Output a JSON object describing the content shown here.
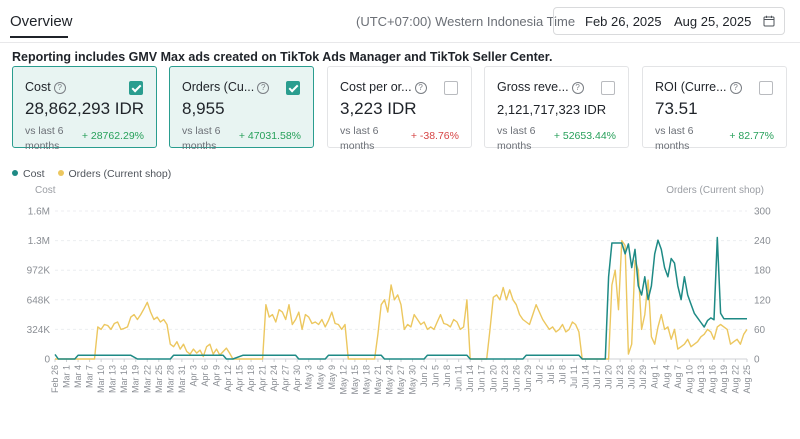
{
  "header": {
    "tab_label": "Overview",
    "timezone": "(UTC+07:00) Western Indonesia Time",
    "date_start": "Feb 26, 2025",
    "date_separator": "-",
    "date_end": "Aug 25, 2025",
    "calendar_icon": "calendar-icon"
  },
  "notice": "Reporting includes GMV Max ads created on TikTok Ads Manager and TikTok Seller Center.",
  "metrics": [
    {
      "title": "Cost",
      "value": "28,862,293 IDR",
      "vs": "vs last 6 months",
      "change": "+ 28762.29%",
      "direction": "up",
      "checked": true
    },
    {
      "title": "Orders (Cu...",
      "value": "8,955",
      "vs": "vs last 6 months",
      "change": "+ 47031.58%",
      "direction": "up",
      "checked": true
    },
    {
      "title": "Cost per or...",
      "value": "3,223 IDR",
      "vs": "vs last 6 months",
      "change": "+ -38.76%",
      "direction": "down",
      "checked": false
    },
    {
      "title": "Gross reve...",
      "value": "2,121,717,323 IDR",
      "vs": "vs last 6 months",
      "change": "+ 52653.44%",
      "direction": "up",
      "checked": false
    },
    {
      "title": "ROI (Curre...",
      "value": "73.51",
      "vs": "vs last 6 months",
      "change": "+ 82.77%",
      "direction": "up",
      "checked": false
    }
  ],
  "colors": {
    "cost": "#1e8a85",
    "orders": "#ecc75f",
    "accent": "#2a9d8f",
    "up": "#27a05a",
    "down": "#d64545"
  },
  "chart_data": {
    "type": "line",
    "legend": [
      "Cost",
      "Orders (Current shop)"
    ],
    "y_left_label": "Cost",
    "y_right_label": "Orders (Current shop)",
    "y_left_ticks": [
      "0",
      "324K",
      "648K",
      "972K",
      "1.3M",
      "1.6M"
    ],
    "y_right_ticks": [
      "0",
      "60",
      "120",
      "180",
      "240",
      "300"
    ],
    "y_left_range": [
      0,
      1620000
    ],
    "y_right_range": [
      0,
      300
    ],
    "x_start": "2025-02-26",
    "x_labels": [
      "Feb 26",
      "Mar 1",
      "Mar 4",
      "Mar 7",
      "Mar 10",
      "Mar 13",
      "Mar 16",
      "Mar 19",
      "Mar 22",
      "Mar 25",
      "Mar 28",
      "Mar 31",
      "Apr 3",
      "Apr 6",
      "Apr 9",
      "Apr 12",
      "Apr 15",
      "Apr 18",
      "Apr 21",
      "Apr 24",
      "Apr 27",
      "Apr 30",
      "May 3",
      "May 6",
      "May 9",
      "May 12",
      "May 15",
      "May 18",
      "May 21",
      "May 24",
      "May 27",
      "May 30",
      "Jun 2",
      "Jun 5",
      "Jun 8",
      "Jun 11",
      "Jun 14",
      "Jun 17",
      "Jun 20",
      "Jun 23",
      "Jun 26",
      "Jun 29",
      "Jul 2",
      "Jul 5",
      "Jul 8",
      "Jul 11",
      "Jul 14",
      "Jul 17",
      "Jul 20",
      "Jul 23",
      "Jul 26",
      "Jul 29",
      "Aug 1",
      "Aug 4",
      "Aug 7",
      "Aug 10",
      "Aug 13",
      "Aug 16",
      "Aug 19",
      "Aug 22",
      "Aug 25"
    ],
    "cost_series": {
      "name": "Cost",
      "segments": [
        [
          0,
          50000
        ],
        [
          1,
          0
        ],
        [
          5,
          0
        ],
        [
          6,
          0
        ],
        [
          7,
          40000
        ],
        [
          8,
          40000
        ],
        [
          23,
          40000
        ],
        [
          25,
          0
        ],
        [
          35,
          0
        ],
        [
          36,
          40000
        ],
        [
          51,
          40000
        ],
        [
          52,
          0
        ],
        [
          54,
          0
        ],
        [
          57,
          40000
        ],
        [
          73,
          40000
        ],
        [
          74,
          0
        ],
        [
          82,
          0
        ],
        [
          83,
          40000
        ],
        [
          99,
          40000
        ],
        [
          100,
          0
        ],
        [
          112,
          0
        ],
        [
          113,
          40000
        ],
        [
          125,
          40000
        ],
        [
          126,
          0
        ],
        [
          142,
          0
        ],
        [
          143,
          40000
        ],
        [
          159,
          40000
        ],
        [
          160,
          0
        ],
        [
          167,
          0
        ],
        [
          168,
          900000
        ],
        [
          169,
          1270000
        ],
        [
          172,
          1270000
        ],
        [
          173,
          1150000
        ],
        [
          174,
          1260000
        ],
        [
          175,
          1000000
        ],
        [
          176,
          1200000
        ],
        [
          177,
          800000
        ],
        [
          178,
          700000
        ],
        [
          179,
          900000
        ],
        [
          180,
          650000
        ],
        [
          181,
          800000
        ],
        [
          182,
          1150000
        ],
        [
          183,
          1300000
        ],
        [
          184,
          1200000
        ],
        [
          185,
          1000000
        ],
        [
          186,
          900000
        ],
        [
          187,
          1100000
        ],
        [
          188,
          1050000
        ],
        [
          189,
          800000
        ],
        [
          190,
          650000
        ],
        [
          191,
          900000
        ],
        [
          192,
          700000
        ],
        [
          193,
          600000
        ],
        [
          194,
          500000
        ],
        [
          195,
          450000
        ],
        [
          196,
          400000
        ],
        [
          197,
          350000
        ],
        [
          198,
          420000
        ],
        [
          199,
          450000
        ],
        [
          200,
          430000
        ],
        [
          201,
          1330000
        ],
        [
          202,
          500000
        ],
        [
          203,
          440000
        ],
        [
          204,
          440000
        ],
        [
          210,
          440000
        ]
      ]
    },
    "orders_series": {
      "name": "Orders (Current shop)",
      "values": [
        [
          0,
          0
        ],
        [
          12,
          0
        ],
        [
          13,
          65
        ],
        [
          14,
          60
        ],
        [
          15,
          70
        ],
        [
          16,
          68
        ],
        [
          17,
          60
        ],
        [
          18,
          72
        ],
        [
          19,
          75
        ],
        [
          20,
          60
        ],
        [
          21,
          62
        ],
        [
          22,
          65
        ],
        [
          23,
          85
        ],
        [
          24,
          90
        ],
        [
          25,
          80
        ],
        [
          26,
          90
        ],
        [
          27,
          102
        ],
        [
          28,
          115
        ],
        [
          29,
          95
        ],
        [
          30,
          80
        ],
        [
          31,
          85
        ],
        [
          32,
          75
        ],
        [
          33,
          80
        ],
        [
          34,
          70
        ],
        [
          35,
          30
        ],
        [
          36,
          25
        ],
        [
          37,
          35
        ],
        [
          38,
          20
        ],
        [
          39,
          30
        ],
        [
          40,
          15
        ],
        [
          41,
          10
        ],
        [
          42,
          20
        ],
        [
          43,
          12
        ],
        [
          44,
          18
        ],
        [
          45,
          5
        ],
        [
          46,
          25
        ],
        [
          47,
          30
        ],
        [
          48,
          10
        ],
        [
          49,
          20
        ],
        [
          50,
          8
        ],
        [
          51,
          15
        ],
        [
          52,
          22
        ],
        [
          53,
          12
        ],
        [
          54,
          0
        ],
        [
          63,
          0
        ],
        [
          64,
          110
        ],
        [
          65,
          85
        ],
        [
          66,
          90
        ],
        [
          67,
          75
        ],
        [
          68,
          100
        ],
        [
          69,
          95
        ],
        [
          70,
          80
        ],
        [
          71,
          110
        ],
        [
          72,
          70
        ],
        [
          73,
          80
        ],
        [
          74,
          95
        ],
        [
          75,
          60
        ],
        [
          76,
          90
        ],
        [
          77,
          85
        ],
        [
          78,
          72
        ],
        [
          79,
          75
        ],
        [
          80,
          70
        ],
        [
          81,
          80
        ],
        [
          82,
          65
        ],
        [
          83,
          78
        ],
        [
          84,
          95
        ],
        [
          85,
          72
        ],
        [
          86,
          70
        ],
        [
          87,
          60
        ],
        [
          88,
          70
        ],
        [
          89,
          0
        ],
        [
          97,
          0
        ],
        [
          98,
          50
        ],
        [
          99,
          110
        ],
        [
          100,
          120
        ],
        [
          101,
          95
        ],
        [
          102,
          150
        ],
        [
          103,
          120
        ],
        [
          104,
          130
        ],
        [
          105,
          110
        ],
        [
          106,
          60
        ],
        [
          107,
          70
        ],
        [
          108,
          65
        ],
        [
          109,
          90
        ],
        [
          110,
          80
        ],
        [
          111,
          70
        ],
        [
          112,
          75
        ],
        [
          113,
          60
        ],
        [
          114,
          65
        ],
        [
          115,
          60
        ],
        [
          116,
          75
        ],
        [
          117,
          90
        ],
        [
          118,
          72
        ],
        [
          119,
          70
        ],
        [
          120,
          65
        ],
        [
          121,
          80
        ],
        [
          122,
          75
        ],
        [
          123,
          60
        ],
        [
          124,
          65
        ],
        [
          125,
          120
        ],
        [
          126,
          0
        ],
        [
          131,
          0
        ],
        [
          132,
          60
        ],
        [
          133,
          125
        ],
        [
          134,
          130
        ],
        [
          135,
          120
        ],
        [
          136,
          145
        ],
        [
          137,
          120
        ],
        [
          138,
          140
        ],
        [
          139,
          120
        ],
        [
          140,
          110
        ],
        [
          141,
          90
        ],
        [
          142,
          80
        ],
        [
          143,
          75
        ],
        [
          144,
          70
        ],
        [
          145,
          90
        ],
        [
          146,
          110
        ],
        [
          147,
          95
        ],
        [
          148,
          80
        ],
        [
          149,
          70
        ],
        [
          150,
          60
        ],
        [
          151,
          65
        ],
        [
          152,
          55
        ],
        [
          153,
          60
        ],
        [
          154,
          70
        ],
        [
          155,
          55
        ],
        [
          156,
          60
        ],
        [
          157,
          75
        ],
        [
          158,
          70
        ],
        [
          159,
          55
        ],
        [
          160,
          0
        ],
        [
          168,
          0
        ],
        [
          169,
          150
        ],
        [
          170,
          180
        ],
        [
          171,
          100
        ],
        [
          172,
          240
        ],
        [
          173,
          230
        ],
        [
          174,
          10
        ],
        [
          175,
          30
        ],
        [
          176,
          200
        ],
        [
          177,
          180
        ],
        [
          178,
          60
        ],
        [
          179,
          90
        ],
        [
          180,
          160
        ],
        [
          181,
          45
        ],
        [
          182,
          30
        ],
        [
          183,
          65
        ],
        [
          184,
          90
        ],
        [
          185,
          60
        ],
        [
          186,
          65
        ],
        [
          187,
          40
        ],
        [
          188,
          60
        ],
        [
          189,
          20
        ],
        [
          190,
          25
        ],
        [
          191,
          30
        ],
        [
          192,
          40
        ],
        [
          193,
          25
        ],
        [
          194,
          30
        ],
        [
          195,
          35
        ],
        [
          196,
          45
        ],
        [
          197,
          50
        ],
        [
          198,
          60
        ],
        [
          199,
          55
        ],
        [
          200,
          40
        ],
        [
          201,
          65
        ],
        [
          202,
          70
        ],
        [
          203,
          65
        ],
        [
          204,
          60
        ],
        [
          205,
          30
        ],
        [
          206,
          35
        ],
        [
          207,
          40
        ],
        [
          208,
          30
        ],
        [
          209,
          50
        ],
        [
          210,
          60
        ]
      ]
    }
  }
}
